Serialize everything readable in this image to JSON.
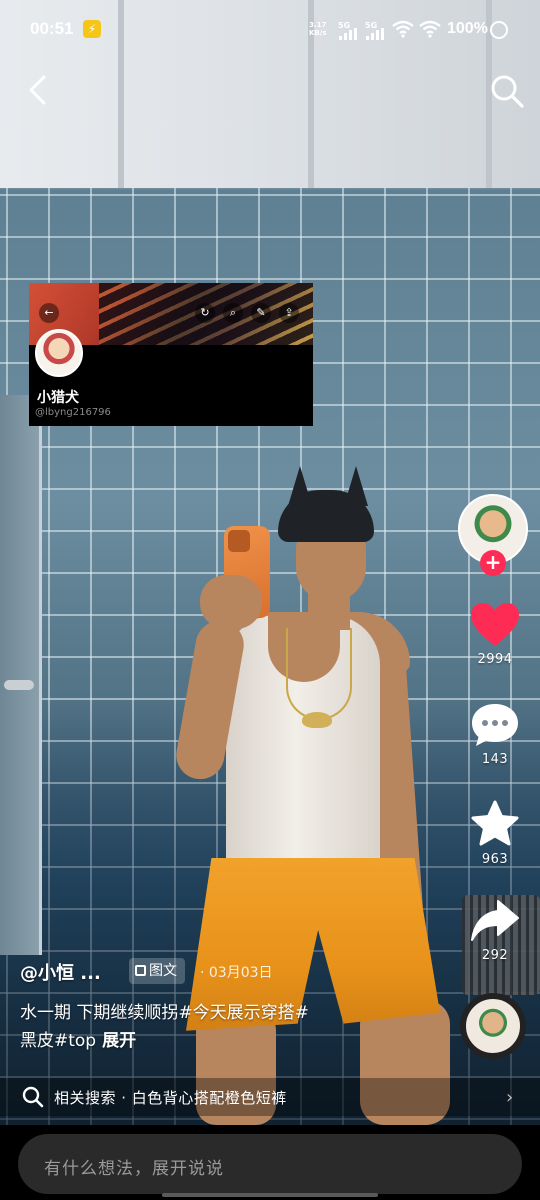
{
  "status_bar": {
    "time": "00:51",
    "net_speed_value": "3.17",
    "net_speed_unit": "KB/s",
    "network_1": "5G",
    "network_2": "5G",
    "battery": "100%"
  },
  "profile_card": {
    "name": "小猎犬",
    "handle": "@lbyng216796"
  },
  "actions": {
    "likes": "2994",
    "comments": "143",
    "favorites": "963",
    "shares": "292"
  },
  "post": {
    "author": "@小恒 ...",
    "type_badge": "图文",
    "date": "· 03月03日",
    "caption_line1": "水一期 下期继续顺拐#今天展示穿搭#",
    "caption_line2": "黑皮#top",
    "expand_label": "展开"
  },
  "related_search": {
    "text": "相关搜索 · 白色背心搭配橙色短裤"
  },
  "comment_input": {
    "placeholder": "有什么想法，展开说说"
  },
  "colors": {
    "like_red": "#fe2c55",
    "follow_red": "#fe2c55",
    "accent_orange": "#e8921a"
  },
  "icons": {
    "back": "chevron-left-icon",
    "search": "search-icon",
    "like": "heart-icon",
    "comment": "speech-bubble-icon",
    "favorite": "star-icon",
    "share": "share-arrow-icon"
  }
}
